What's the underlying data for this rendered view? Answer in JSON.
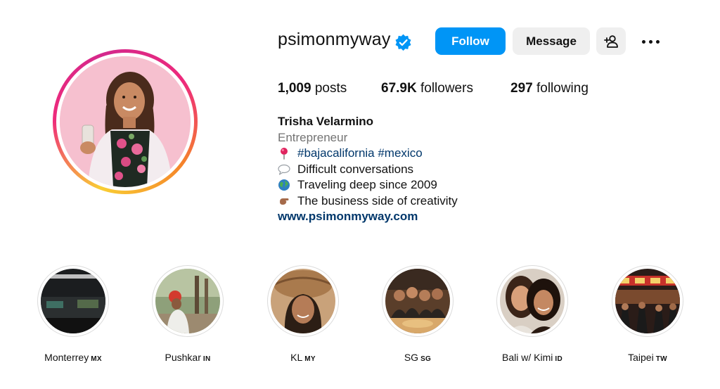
{
  "profile": {
    "username": "psimonmyway",
    "verified": true,
    "buttons": {
      "follow": "Follow",
      "message": "Message"
    },
    "stats": {
      "posts_count": "1,009",
      "posts_label": "posts",
      "followers_count": "67.9K",
      "followers_label": "followers",
      "following_count": "297",
      "following_label": "following"
    },
    "bio": {
      "name": "Trisha Velarmino",
      "category": "Entrepreneur",
      "location_tags": "#bajacalifornia #mexico",
      "line2": "Difficult conversations",
      "line3": "Traveling deep since 2009",
      "line4": "The business side of creativity",
      "website": "www.psimonmyway.com"
    }
  },
  "highlights": [
    {
      "label": "Monterrey",
      "code": "MX"
    },
    {
      "label": "Pushkar",
      "code": "IN"
    },
    {
      "label": "KL",
      "code": "MY"
    },
    {
      "label": "SG",
      "code": "SG"
    },
    {
      "label": "Bali w/ Kimi",
      "code": "ID"
    },
    {
      "label": "Taipei",
      "code": "TW"
    }
  ],
  "colors": {
    "follow_button": "#0095f6",
    "secondary_button": "#efefef",
    "link": "#00376b",
    "muted": "#737373",
    "verified": "#0095f6"
  },
  "icons": [
    "verified-badge-icon",
    "add-user-icon",
    "more-options-icon",
    "pin-icon",
    "speech-bubble-icon",
    "globe-icon",
    "hand-icon"
  ]
}
